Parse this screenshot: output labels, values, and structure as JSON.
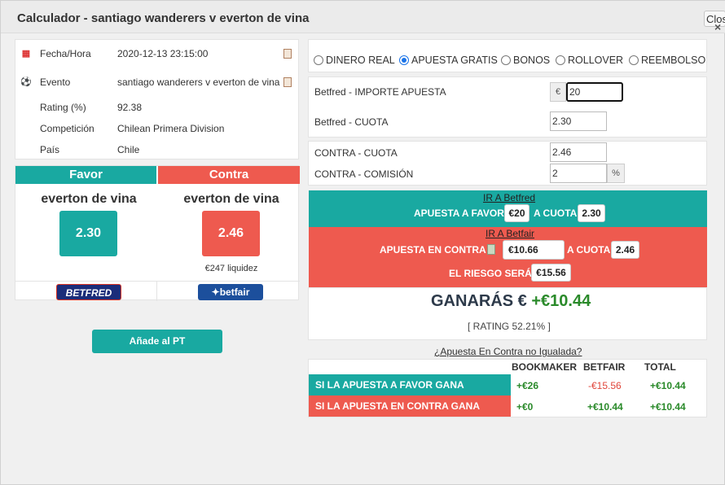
{
  "window": {
    "title": "Calculador - santiago wanderers v everton de vina",
    "close_label": "Close",
    "close_icon": "×"
  },
  "event_info": {
    "rows": [
      {
        "label": "Fecha/Hora",
        "value": "2020-12-13 23:15:00",
        "icon": "calendar-icon"
      },
      {
        "label": "Evento",
        "value": "santiago wanderers v everton de vina",
        "icon": "soccer-ball-icon"
      },
      {
        "label": "Rating (%)",
        "value": "92.38"
      },
      {
        "label": "Competición",
        "value": "Chilean Primera Division"
      },
      {
        "label": "País",
        "value": "Chile"
      }
    ]
  },
  "favor": {
    "header": "Favor",
    "team": "everton de vina",
    "odds": "2.30",
    "bookmaker": "BETFRED",
    "color": "#19a9a1"
  },
  "contra": {
    "header": "Contra",
    "team": "everton de vina",
    "odds": "2.46",
    "liquidity": "€247 liquidez",
    "exchange": "betfair",
    "color": "#ee5a4f"
  },
  "add_button": "Añade al PT",
  "bet_types": {
    "options": [
      "DINERO REAL",
      "APUESTA GRATIS",
      "BONOS",
      "ROLLOVER",
      "REEMBOLSO"
    ],
    "selected": "APUESTA GRATIS"
  },
  "form": {
    "stake_label": "Betfred - IMPORTE APUESTA",
    "currency": "€",
    "stake_value": "20",
    "back_odds_label": "Betfred - CUOTA",
    "back_odds_value": "2.30",
    "lay_odds_label": "CONTRA - CUOTA",
    "lay_odds_value": "2.46",
    "commission_label": "CONTRA - COMISIÓN",
    "commission_value": "2",
    "commission_unit": "%"
  },
  "back_band": {
    "link": "IR A Betfred",
    "text": "APUESTA A FAVOR",
    "stake": "€20",
    "odds_text": "A CUOTA",
    "odds": "2.30"
  },
  "lay_band": {
    "link": "IR A Betfair",
    "text": "APUESTA EN CONTRA",
    "stake": "€10.66",
    "odds_text": "A CUOTA",
    "odds": "2.46",
    "risk_text": "EL RIESGO SERÁ",
    "risk": "€15.56"
  },
  "result": {
    "profit_label": "GANARÁS €",
    "profit_value": "+€10.44",
    "rating": "[ RATING 52.21% ]"
  },
  "unmatched_link": "¿Apuesta En Contra no Igualada?",
  "outcome_table": {
    "columns": [
      "BOOKMAKER",
      "BETFAIR",
      "TOTAL"
    ],
    "rows": [
      {
        "label": "SI LA APUESTA A FAVOR GANA",
        "bookmaker": "+€26",
        "betfair": "-€15.56",
        "total": "+€10.44"
      },
      {
        "label": "SI LA APUESTA EN CONTRA GANA",
        "bookmaker": "+€0",
        "betfair": "+€10.44",
        "total": "+€10.44"
      }
    ]
  }
}
